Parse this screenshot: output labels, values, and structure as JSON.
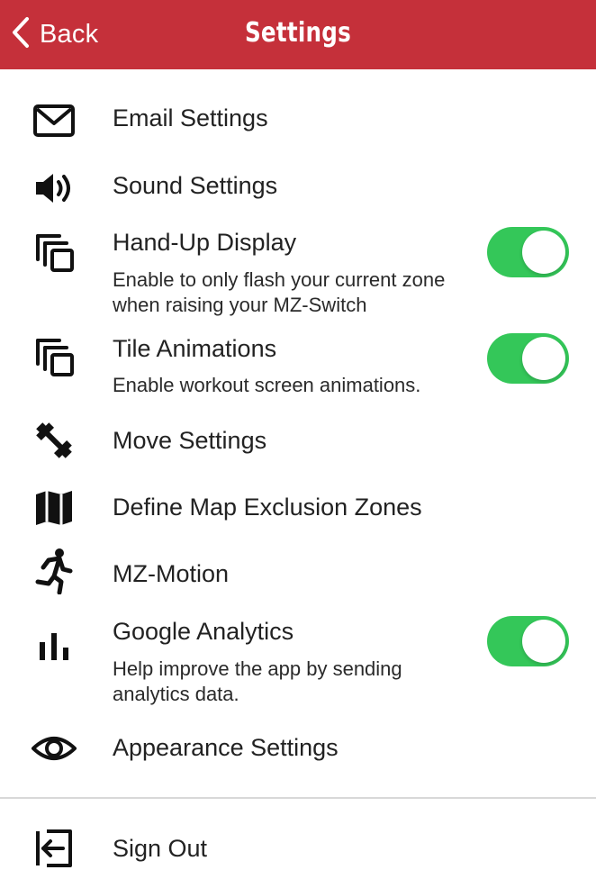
{
  "header": {
    "back_label": "Back",
    "title": "Settings",
    "background_color": "#c5303a"
  },
  "settings": [
    {
      "label": "Email Settings",
      "icon": "envelope-icon"
    },
    {
      "label": "Sound Settings",
      "icon": "speaker-icon"
    },
    {
      "label": "Hand-Up Display",
      "icon": "layers-icon",
      "description": "Enable to only flash your current zone when raising your MZ-Switch",
      "toggle_on": true
    },
    {
      "label": "Tile Animations",
      "icon": "layers-icon",
      "description": "Enable workout screen animations.",
      "toggle_on": true
    },
    {
      "label": "Move Settings",
      "icon": "dumbbell-icon"
    },
    {
      "label": "Define Map Exclusion Zones",
      "icon": "map-icon"
    },
    {
      "label": "MZ-Motion",
      "icon": "running-person-icon"
    },
    {
      "label": "Google Analytics",
      "icon": "bar-chart-icon",
      "description": "Help improve the app by sending analytics data.",
      "toggle_on": true
    },
    {
      "label": "Appearance Settings",
      "icon": "eye-icon"
    }
  ],
  "sign_out": {
    "label": "Sign Out",
    "icon": "sign-out-icon"
  },
  "colors": {
    "toggle_on": "#34c759",
    "divider": "#d8d8d8"
  }
}
